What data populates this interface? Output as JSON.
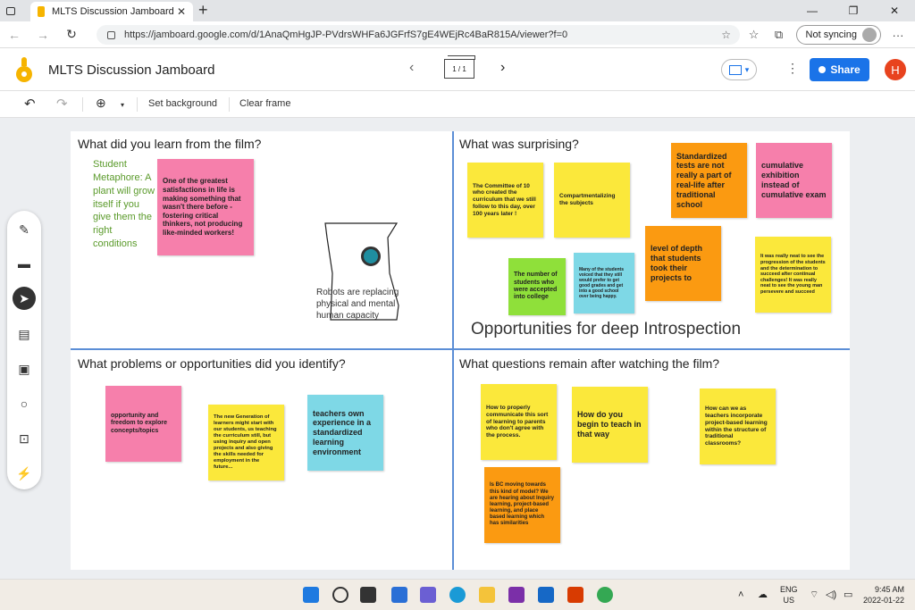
{
  "browser": {
    "tab_title": "MLTS Discussion Jamboard - Goo",
    "tab_close": "✕",
    "new_tab": "+",
    "url": "https://jamboard.google.com/d/1AnaQmHgJP-PVdrsWHFa6JGFrfS7gE4WEjRc4BaR815A/viewer?f=0",
    "profile_label": "Not syncing",
    "more": "···",
    "win_min": "—",
    "win_max": "❐",
    "win_close": "✕"
  },
  "jamboard": {
    "title": "MLTS Discussion Jamboard",
    "frame_counter": "1 / 1",
    "share_label": "Share",
    "avatar_letter": "H"
  },
  "toolbar": {
    "set_background": "Set background",
    "clear_frame": "Clear frame"
  },
  "board": {
    "q1": {
      "title": "What did you learn from the film?",
      "green_text": "Student Metaphore: A plant will grow itself if you give them the right conditions",
      "note1": "One of the greatest satisfactions in life is making something that wasn't there before - fostering critical thinkers, not producing like-minded workers!",
      "robot_text": "Robots are  replacing physical and mental human capacity"
    },
    "q2": {
      "title": "What was surprising?",
      "note1": "The Committee of 10 who created the curriculum that we still follow to this day, over 100 years later !",
      "note2": "Compartmentalizing the subjects",
      "note3": "Standardized tests are not really a part of real-life after traditional school",
      "note4": "cumulative exhibition instead of cumulative exam",
      "note5": "The number of students who were accepted into college",
      "note6": "Many of the students voiced that they still would prefer to get good grades and get into a good school over being happy.",
      "note7": "level of depth that students took their projects to",
      "note8": "It was really neat to see the progression of the students and the determination to succeed after continual challenges! It was really neat to see the young man persevere and succeed",
      "big_text": "Opportunities for deep Introspection"
    },
    "q3": {
      "title": "What problems or opportunities did you identify?",
      "note1": "opportunity and freedom to explore concepts/topics",
      "note2": "The new Generation of learners might start with our students, us teaching the curriculum still, but using inquiry and open projects and also giving the skills needed for employment in the future...",
      "note3": "teachers own experience in a standardized learning environment"
    },
    "q4": {
      "title": "What questions remain after watching the film?",
      "note1": "How to properly communicate this sort of learning to parents who don't agree with the process.",
      "note2": "How do you begin to teach in that way",
      "note3": "How can we as teachers incorporate project-based learning within the structure of traditional classrooms?",
      "note4": "Is BC moving towards this kind of model? We are hearing about Inquiry learning, project-based learning, and place based learning which has similarities"
    }
  },
  "taskbar": {
    "lang1": "ENG",
    "lang2": "US",
    "time": "9:45 AM",
    "date": "2022-01-22"
  },
  "colors": {
    "yellow": "#fbe83b",
    "pink": "#f67fab",
    "orange": "#fb9a11",
    "green": "#8fe03a",
    "cyan": "#7ed8e6",
    "divider": "#5b8ed6",
    "share_blue": "#1a73e8"
  }
}
